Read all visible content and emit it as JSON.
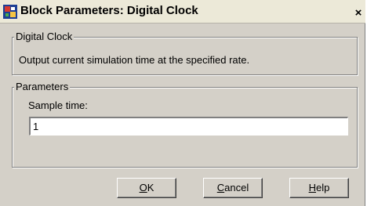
{
  "window": {
    "title": "Block Parameters: Digital Clock",
    "close_glyph": "×",
    "icon": "simulink-block-icon"
  },
  "description_group": {
    "legend": "Digital Clock",
    "text": "Output current simulation time at the specified rate."
  },
  "parameters_group": {
    "legend": "Parameters",
    "sample_time_label": "Sample time:",
    "sample_time_value": "1"
  },
  "buttons": {
    "ok": {
      "mnemonic": "O",
      "rest": "K"
    },
    "cancel": {
      "mnemonic": "C",
      "rest": "ancel"
    },
    "help": {
      "mnemonic": "H",
      "rest": "elp"
    }
  }
}
